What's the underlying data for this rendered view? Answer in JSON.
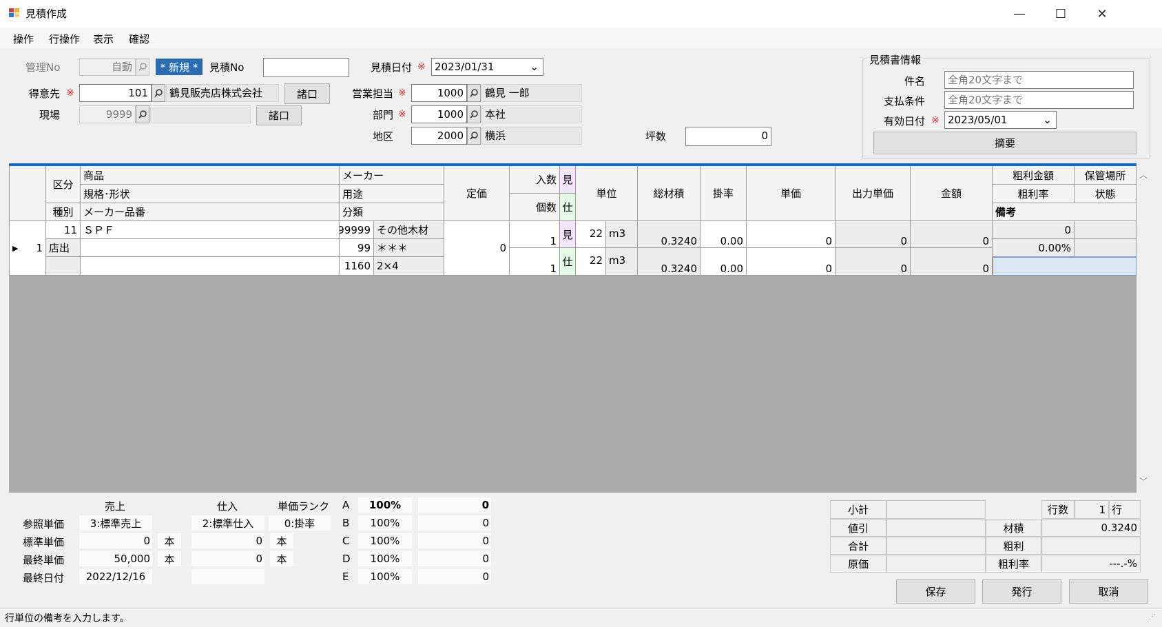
{
  "window": {
    "title": "見積作成",
    "minimize": "—",
    "maximize": "☐",
    "close": "✕"
  },
  "menu": [
    "操作",
    "行操作",
    "表示",
    "確認"
  ],
  "header": {
    "kanri_label": "管理No",
    "kanri_value": "自動",
    "new_badge": "* 新規 *",
    "mitsumori_no_label": "見積No",
    "mitsumori_no_value": "",
    "date_label": "見積日付",
    "date_value": "2023/01/31",
    "customer_label": "得意先",
    "customer_code": "101",
    "customer_name": "鶴見販売店株式会社",
    "customer_btn": "諸口",
    "site_label": "現場",
    "site_code": "9999",
    "site_name": "",
    "site_btn": "諸口",
    "sales_label": "営業担当",
    "sales_code": "1000",
    "sales_name": "鶴見 一郎",
    "dept_label": "部門",
    "dept_code": "1000",
    "dept_name": "本社",
    "area_label": "地区",
    "area_code": "2000",
    "area_name": "横浜",
    "tsubo_label": "坪数",
    "tsubo_value": "0",
    "required_mark": "※"
  },
  "quote_info": {
    "title": "見積書情報",
    "subject_label": "件名",
    "subject_placeholder": "全角20文字まで",
    "payment_label": "支払条件",
    "payment_placeholder": "全角20文字まで",
    "valid_label": "有効日付",
    "valid_value": "2023/05/01",
    "summary_btn": "摘要"
  },
  "grid": {
    "headers": {
      "kubun": "区分",
      "shubetsu": "種別",
      "shohin": "商品",
      "kikaku": "規格･形状",
      "maker_hinban": "メーカー品番",
      "maker": "メーカー",
      "yoto": "用途",
      "bunrui": "分類",
      "teika": "定価",
      "irisu": "入数",
      "kosu": "個数",
      "mi": "見",
      "shi": "仕",
      "tani": "単位",
      "sozaiseki": "総材積",
      "kakeritsu": "掛率",
      "tanka": "単価",
      "shutsuryoku_tanka": "出力単価",
      "kingaku": "金額",
      "arari_kingaku": "粗利金額",
      "hokan_basho": "保管場所",
      "arari_ritsu": "粗利率",
      "jotai": "状態",
      "biko": "備考"
    },
    "row": {
      "indicator": "▶",
      "no": "1",
      "kubun_code": "11",
      "kubun_text": "店出",
      "product": "ＳＰＦ",
      "kikaku": "",
      "hinban": "",
      "maker_code": "99999",
      "maker_name": "その他木材",
      "yoto_code": "99",
      "yoto_name": "＊＊＊",
      "bunrui_code": "1160",
      "bunrui_name": "2×4",
      "teika": "0",
      "irisu_mi": "1",
      "irisu_shi": "1",
      "mi": "見",
      "shi": "仕",
      "tani_mi_qty": "22",
      "tani_mi_unit": "m3",
      "tani_shi_qty": "22",
      "tani_shi_unit": "m3",
      "sozaiseki_mi": "0.3240",
      "sozaiseki_shi": "0.3240",
      "kakeritsu_mi": "0.00",
      "kakeritsu_shi": "0.00",
      "tanka_mi": "0",
      "tanka_shi": "0",
      "shutsu_mi": "0",
      "shutsu_shi": "0",
      "kingaku_mi": "0",
      "kingaku_shi": "0",
      "arari_kingaku": "0",
      "arari_ritsu": "0.00%"
    }
  },
  "price_panel": {
    "uriage": "売上",
    "shiire": "仕入",
    "rank_label": "単価ランク",
    "ref_label": "参照単価",
    "ref_uri": "3:標準売上",
    "ref_shi": "2:標準仕入",
    "rank_value": "0:掛率",
    "std_label": "標準単価",
    "std_uri": "0",
    "std_uri_unit": "本",
    "std_shi": "0",
    "std_shi_unit": "本",
    "last_label": "最終単価",
    "last_uri": "50,000",
    "last_uri_unit": "本",
    "last_shi": "0",
    "last_shi_unit": "本",
    "lastdate_label": "最終日付",
    "lastdate_uri": "2022/12/16",
    "lastdate_shi": "",
    "ranks": [
      {
        "rank": "A",
        "pct": "100%",
        "val": "0"
      },
      {
        "rank": "B",
        "pct": "100%",
        "val": "0"
      },
      {
        "rank": "C",
        "pct": "100%",
        "val": "0"
      },
      {
        "rank": "D",
        "pct": "100%",
        "val": "0"
      },
      {
        "rank": "E",
        "pct": "100%",
        "val": "0"
      }
    ]
  },
  "totals": {
    "subtotal_label": "小計",
    "subtotal": "",
    "discount_label": "値引",
    "discount": "",
    "total_label": "合計",
    "total": "",
    "cost_label": "原価",
    "cost": "",
    "rows_label": "行数",
    "rows_value": "1",
    "rows_unit": "行",
    "zaiseki_label": "材積",
    "zaiseki_value": "0.3240",
    "arari_label": "粗利",
    "arari_value": "",
    "arari_ritsu_label": "粗利率",
    "arari_ritsu_value": "---.-%"
  },
  "actions": {
    "save": "保存",
    "issue": "発行",
    "cancel": "取消"
  },
  "status": {
    "message": "行単位の備考を入力します。"
  }
}
